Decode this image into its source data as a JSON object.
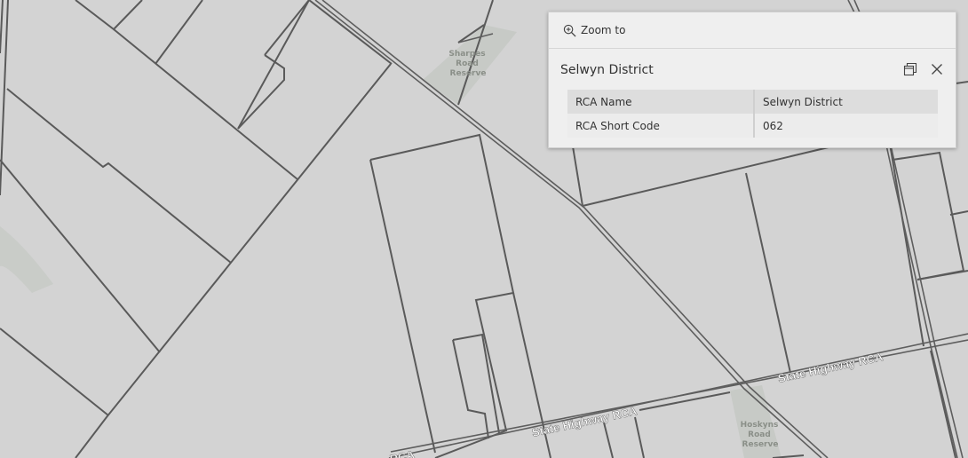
{
  "map": {
    "colors": {
      "background": "#d3d3d3",
      "boundary": "#5a5a5a",
      "road": "#7a7a7a",
      "reserve_fill": "#c6c9c5",
      "reserve_label": "#8a8f88",
      "highway_label": "#ffffff"
    },
    "labels": {
      "sharpes_1": "Sharpes",
      "sharpes_2": "Road",
      "sharpes_3": "Reserve",
      "hoskyns_1": "Hoskyns",
      "hoskyns_2": "Road",
      "hoskyns_3": "Reserve",
      "highway_right": "State Highway RCA",
      "highway_mid": "State Highway RCA",
      "highway_left": "RCA"
    }
  },
  "popup": {
    "zoom_label": "Zoom to",
    "zoom_icon": "zoom-in-icon",
    "title": "Selwyn District",
    "dock_icon": "dock-icon",
    "close_icon": "close-icon",
    "rows": [
      {
        "key": "RCA Name",
        "value": "Selwyn District"
      },
      {
        "key": "RCA Short Code",
        "value": "062"
      }
    ]
  }
}
